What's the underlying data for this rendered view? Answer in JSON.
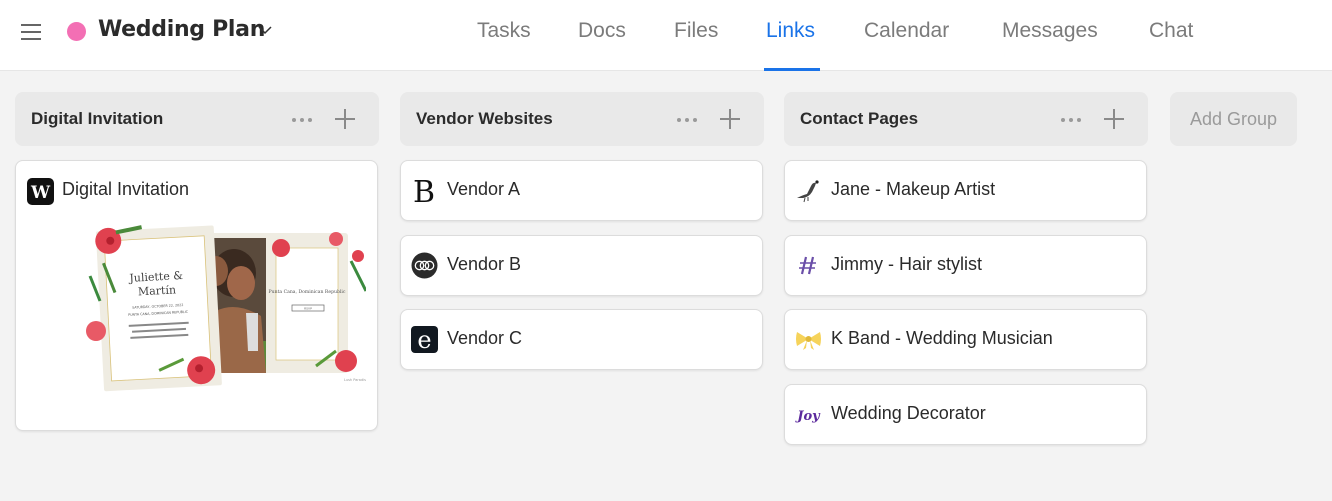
{
  "header": {
    "project_name": "Wedding Plan",
    "project_color": "#f36fb4",
    "menu_icon": "hamburger-icon",
    "dropdown_icon": "chevron-down-icon"
  },
  "tabs": [
    {
      "label": "Tasks",
      "active": false
    },
    {
      "label": "Docs",
      "active": false
    },
    {
      "label": "Files",
      "active": false
    },
    {
      "label": "Links",
      "active": true
    },
    {
      "label": "Calendar",
      "active": false
    },
    {
      "label": "Messages",
      "active": false
    },
    {
      "label": "Chat",
      "active": false
    }
  ],
  "accent_color": "#1a73e8",
  "groups": [
    {
      "title": "Digital Invitation",
      "links": [
        {
          "label": "Digital Invitation",
          "icon": "w-logo-icon",
          "preview": {
            "names_line1": "Juliette &",
            "names_line2": "Martín",
            "date": "SATURDAY, OCTOBER 22, 2022",
            "place": "PUNTA CANA, DOMINICAN REPUBLIC",
            "message": "We are so excited and can't wait to see you. Help us capture our wedding with joy.",
            "right_title": "Punta Cana, Dominican Republic",
            "rsvp": "RSVP",
            "credit": "Lush Paradise"
          }
        }
      ]
    },
    {
      "title": "Vendor Websites",
      "links": [
        {
          "label": "Vendor A",
          "icon": "serif-b-logo-icon"
        },
        {
          "label": "Vendor B",
          "icon": "rings-logo-icon"
        },
        {
          "label": "Vendor C",
          "icon": "e-logo-icon"
        }
      ]
    },
    {
      "title": "Contact Pages",
      "links": [
        {
          "label": "Jane - Makeup Artist",
          "icon": "bird-logo-icon"
        },
        {
          "label": "Jimmy - Hair stylist",
          "icon": "hash-logo-icon"
        },
        {
          "label": "K Band - Wedding Musician",
          "icon": "bow-logo-icon"
        },
        {
          "label": "Wedding Decorator",
          "icon": "joy-logo-icon"
        }
      ]
    }
  ],
  "add_group_label": "Add Group"
}
